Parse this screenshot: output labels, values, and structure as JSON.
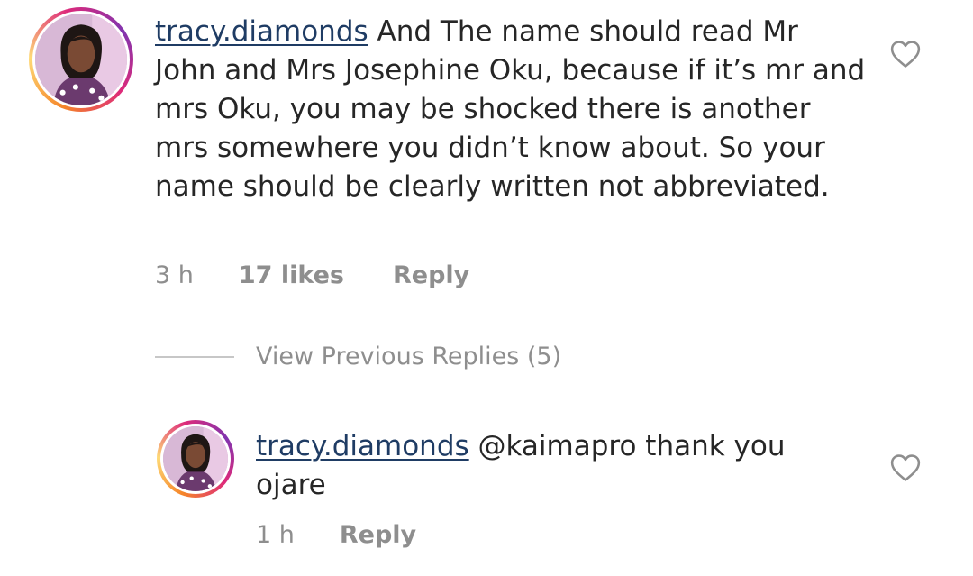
{
  "comment": {
    "username": "tracy.diamonds",
    "text": "And The name should read Mr John and Mrs Josephine Oku, because if it’s mr and mrs Oku, you may be shocked there is another mrs somewhere you didn’t know about. So your name should be clearly written not abbreviated.",
    "time": "3 h",
    "likes": "17 likes",
    "reply_label": "Reply",
    "like_icon": "heart-outline-icon"
  },
  "view_previous": {
    "label": "View Previous Replies (5)"
  },
  "reply": {
    "username": "tracy.diamonds",
    "text": "@kaimapro thank you ojare",
    "time": "1 h",
    "reply_label": "Reply",
    "like_icon": "heart-outline-icon"
  },
  "colors": {
    "username": "#1f3c64",
    "meta": "#8e8e8e",
    "text": "#262626"
  }
}
